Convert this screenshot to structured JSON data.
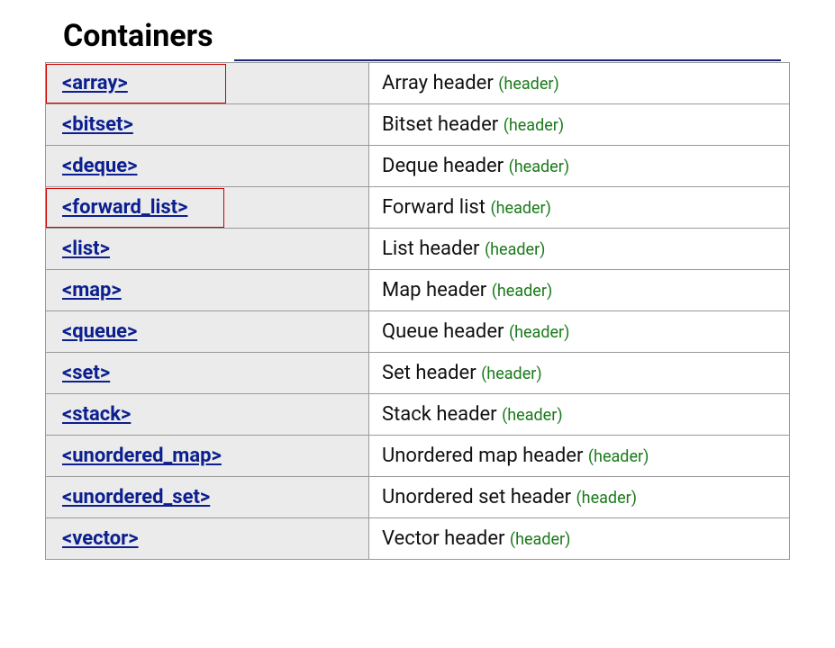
{
  "title": "Containers",
  "header_tag": "(header)",
  "rows": [
    {
      "name": "<array>",
      "desc": "Array header"
    },
    {
      "name": "<bitset>",
      "desc": "Bitset header"
    },
    {
      "name": "<deque>",
      "desc": "Deque header"
    },
    {
      "name": "<forward_list>",
      "desc": "Forward list"
    },
    {
      "name": "<list>",
      "desc": "List header"
    },
    {
      "name": "<map>",
      "desc": "Map header"
    },
    {
      "name": "<queue>",
      "desc": "Queue header"
    },
    {
      "name": "<set>",
      "desc": "Set header"
    },
    {
      "name": "<stack>",
      "desc": "Stack header"
    },
    {
      "name": "<unordered_map>",
      "desc": "Unordered map header"
    },
    {
      "name": "<unordered_set>",
      "desc": "Unordered set header"
    },
    {
      "name": "<vector>",
      "desc": "Vector header"
    }
  ]
}
